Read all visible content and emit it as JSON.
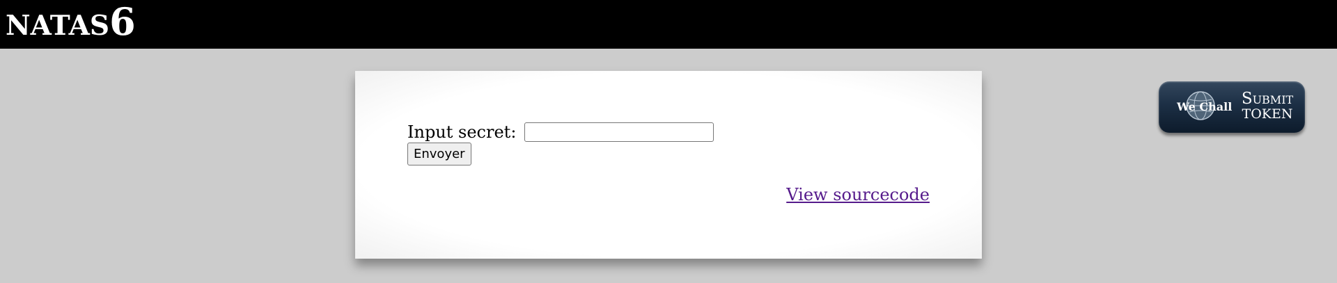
{
  "header": {
    "title_prefix": "NATAS",
    "title_suffix": "6"
  },
  "form": {
    "label": "Input secret:",
    "input_value": "",
    "submit_label": "Envoyer"
  },
  "links": {
    "view_source": "View sourcecode"
  },
  "wechall": {
    "logo_text": "We Chall",
    "line1": "Submit",
    "line2": "TOKEN"
  },
  "colors": {
    "header_bg": "#000000",
    "page_bg": "#cccccc",
    "link_visited": "#551a8b"
  }
}
